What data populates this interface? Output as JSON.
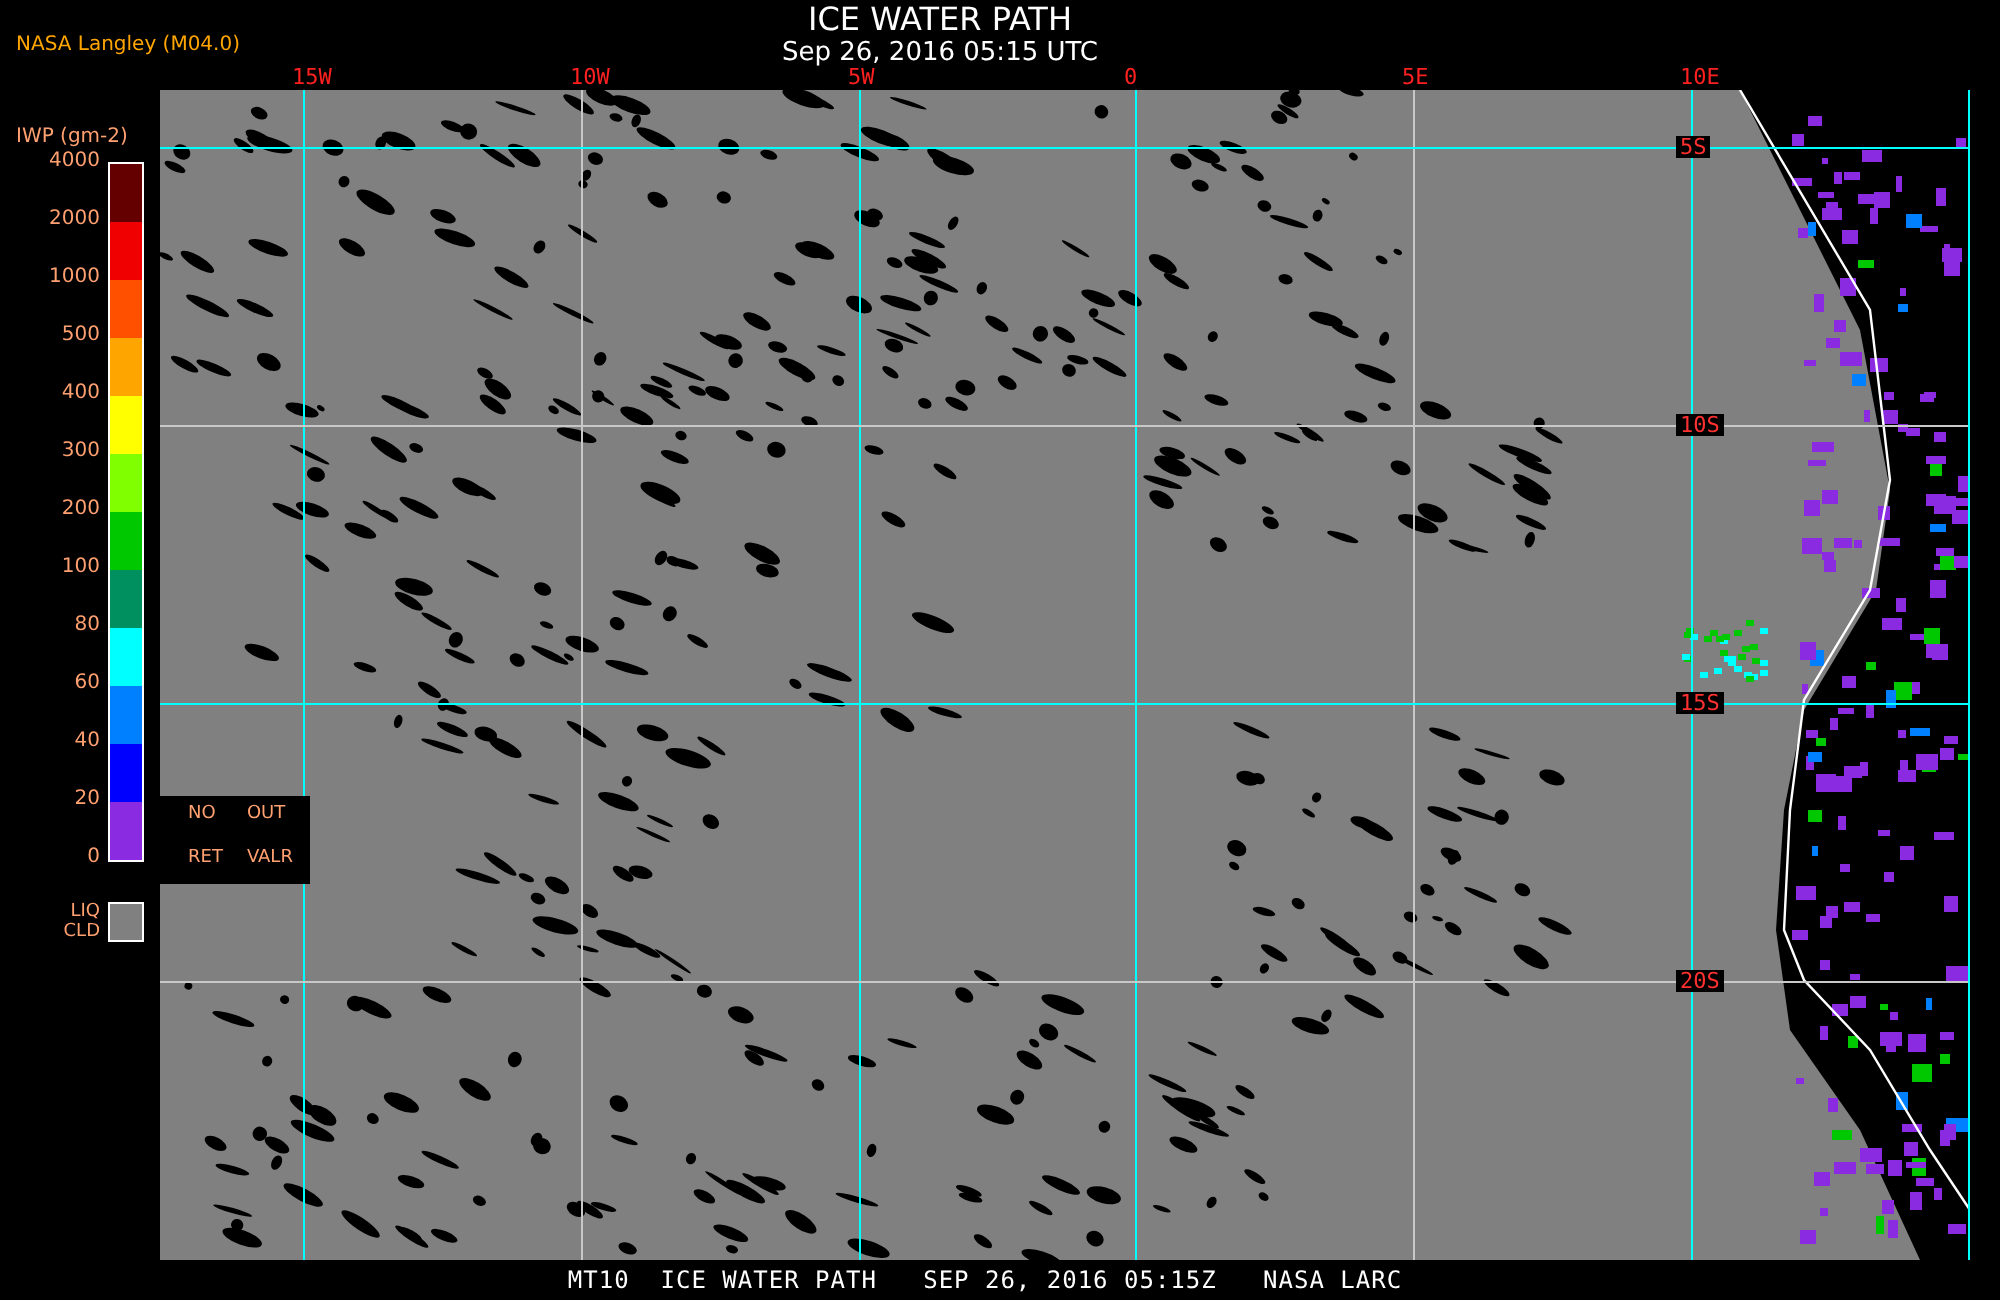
{
  "header": {
    "source": "NASA Langley (M04.0)",
    "title": "ICE WATER PATH",
    "subtitle": "Sep 26, 2016 05:15 UTC"
  },
  "legend": {
    "unit": "IWP (gm-2)",
    "ticks": [
      "4000",
      "2000",
      "1000",
      "500",
      "400",
      "300",
      "200",
      "100",
      "80",
      "60",
      "40",
      "20",
      "0"
    ],
    "bins": [
      {
        "color": "#650000"
      },
      {
        "color": "#f00000"
      },
      {
        "color": "#ff5000"
      },
      {
        "color": "#ffa500"
      },
      {
        "color": "#ffff00"
      },
      {
        "color": "#80ff00"
      },
      {
        "color": "#00c800"
      },
      {
        "color": "#009060"
      },
      {
        "color": "#00ffff"
      },
      {
        "color": "#0080ff"
      },
      {
        "color": "#0000ff"
      },
      {
        "color": "#8a2be2"
      }
    ],
    "liquid_cloud": {
      "lines": [
        "LIQ",
        "CLD"
      ],
      "color": "#808080"
    }
  },
  "map": {
    "longitude_labels": [
      "15W",
      "10W",
      "5W",
      "0",
      "5E",
      "10E"
    ],
    "latitude_labels": [
      "5S",
      "10S",
      "15S",
      "20S"
    ],
    "flags": [
      {
        "lines": [
          "NO",
          "RET"
        ]
      },
      {
        "lines": [
          "OUT",
          "VALR"
        ]
      }
    ]
  },
  "footer": "MT10  ICE WATER PATH   SEP 26, 2016 05:15Z   NASA LARC"
}
